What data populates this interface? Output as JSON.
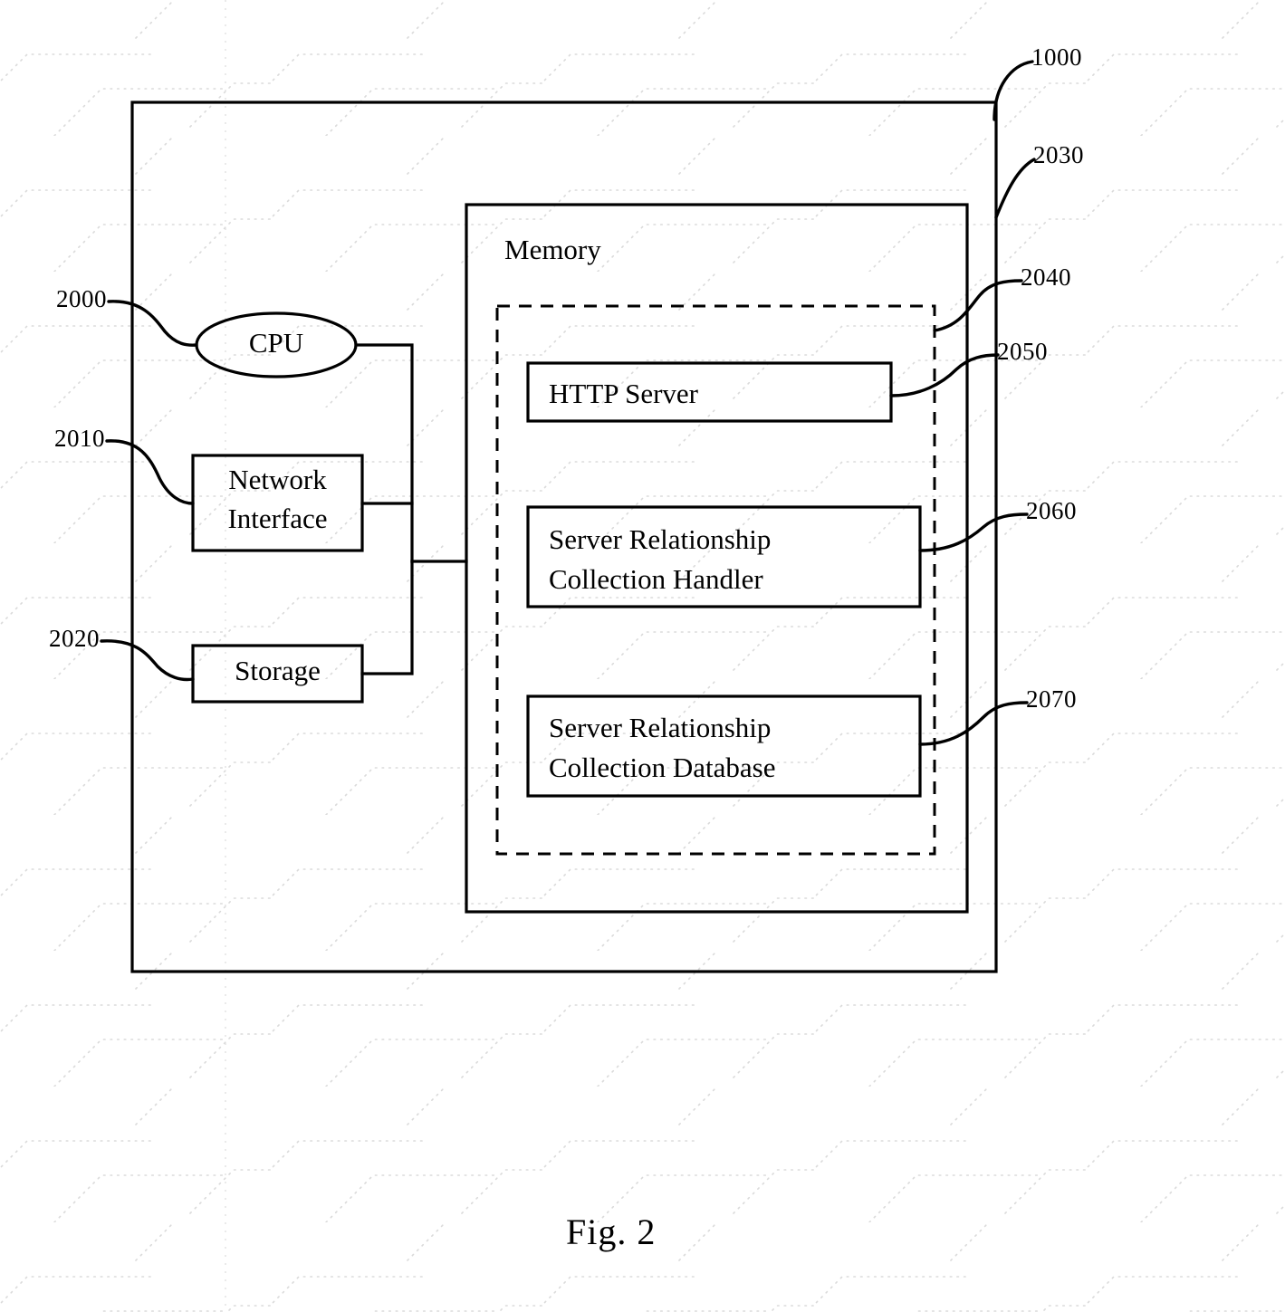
{
  "figure": {
    "caption": "Fig. 2",
    "type": "patent-block-diagram"
  },
  "outer_system": {
    "ref": "1000",
    "name": "server-system-boundary"
  },
  "components": [
    {
      "id": "cpu",
      "label": "CPU",
      "ref": "2000",
      "shape": "ellipse"
    },
    {
      "id": "network-interface",
      "label": "Network\nInterface",
      "ref": "2010",
      "shape": "rect"
    },
    {
      "id": "storage",
      "label": "Storage",
      "ref": "2020",
      "shape": "rect"
    }
  ],
  "memory": {
    "label": "Memory",
    "ref": "2030",
    "program_region": {
      "ref": "2040",
      "style": "dashed"
    },
    "modules": [
      {
        "id": "http-server",
        "label": "HTTP Server",
        "ref": "2050"
      },
      {
        "id": "server-relationship-collection-handler",
        "label": "Server Relationship\nCollection Handler",
        "ref": "2060"
      },
      {
        "id": "server-relationship-collection-database",
        "label": "Server Relationship\nCollection Database",
        "ref": "2070"
      }
    ]
  },
  "ref_numbers": {
    "r1000": "1000",
    "r2000": "2000",
    "r2010": "2010",
    "r2020": "2020",
    "r2030": "2030",
    "r2040": "2040",
    "r2050": "2050",
    "r2060": "2060",
    "r2070": "2070"
  },
  "labels": {
    "cpu": "CPU",
    "network_interface_l1": "Network",
    "network_interface_l2": "Interface",
    "storage": "Storage",
    "memory": "Memory",
    "http_server": "HTTP Server",
    "handler_l1": "Server Relationship",
    "handler_l2": "Collection Handler",
    "database_l1": "Server Relationship",
    "database_l2": "Collection Database",
    "caption": "Fig. 2"
  },
  "colors": {
    "ink": "#000000",
    "paper": "#ffffff",
    "watermark": "#b9b9b9"
  }
}
